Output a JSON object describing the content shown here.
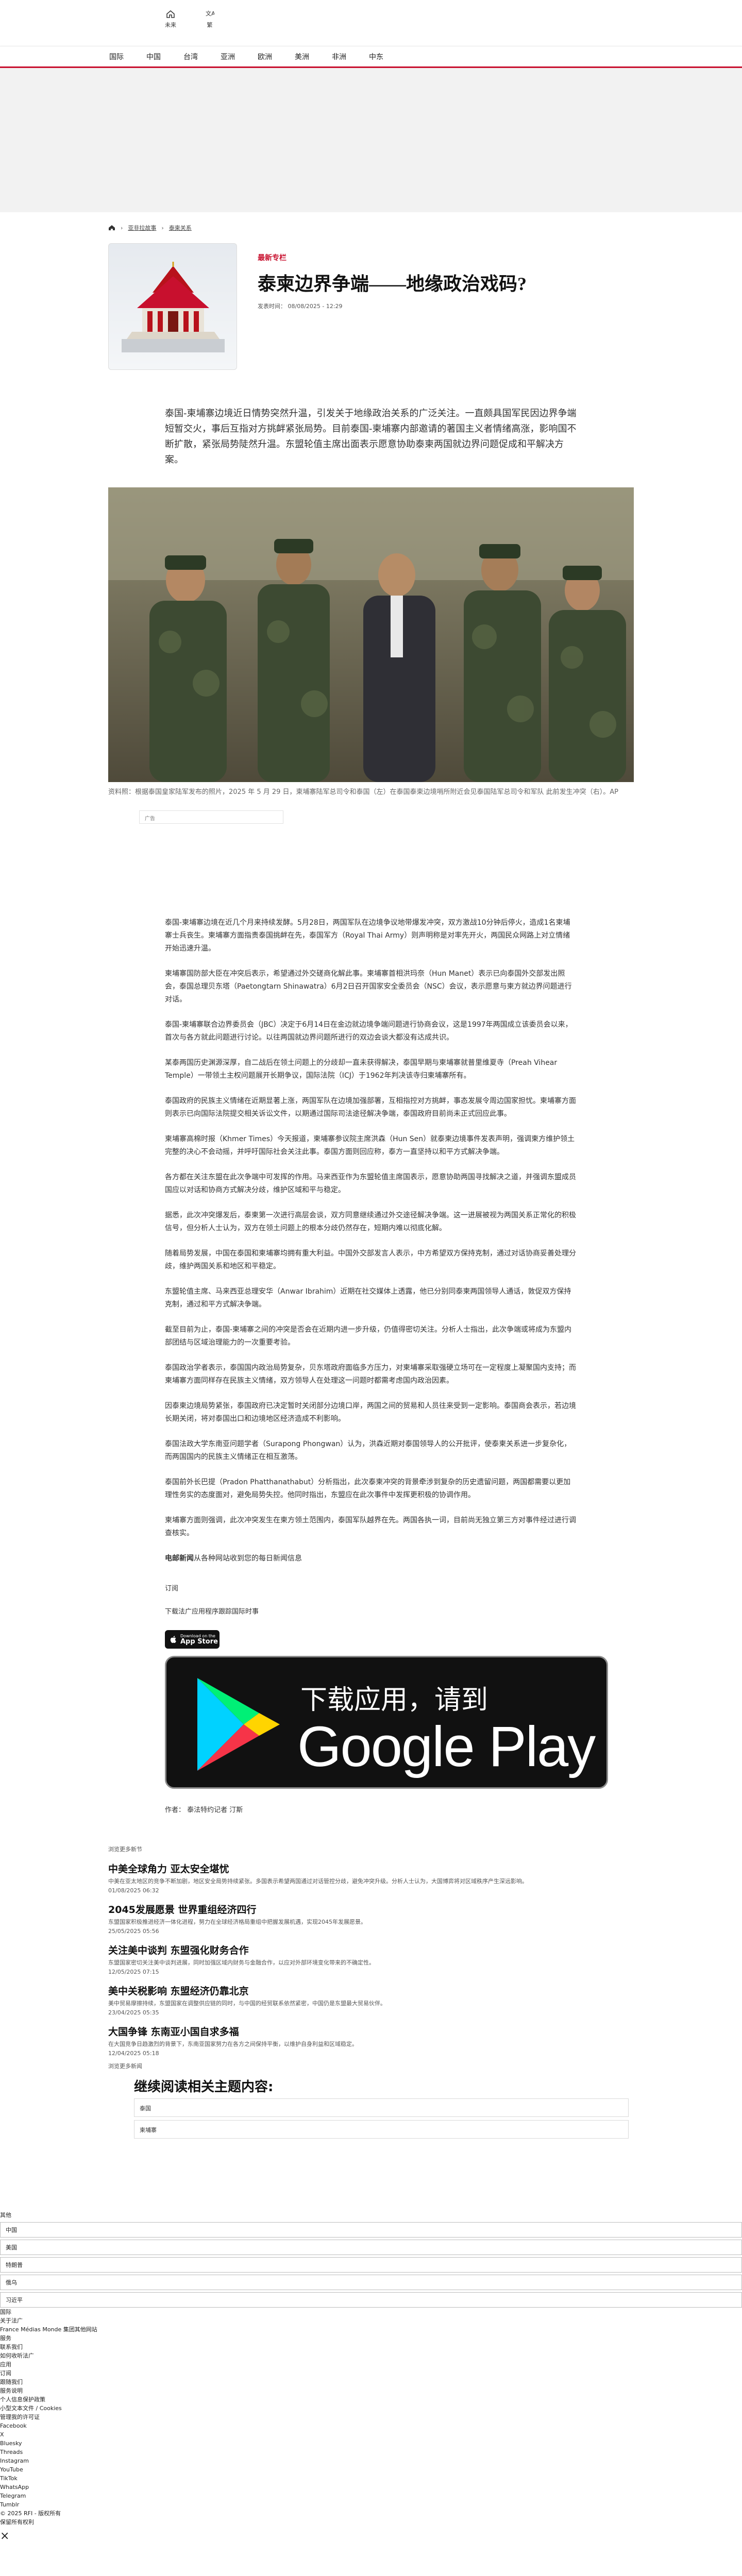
{
  "header": {
    "tools": [
      {
        "icon": "home-icon",
        "label": "未来"
      },
      {
        "icon": "translate-icon",
        "label": "繁"
      }
    ]
  },
  "nav": {
    "items": [
      "国际",
      "中国",
      "台湾",
      "亚洲",
      "欧洲",
      "美洲",
      "非洲",
      "中东"
    ]
  },
  "breadcrumb": {
    "items": [
      "亚非拉故事",
      "泰柬关系"
    ]
  },
  "article": {
    "category": "最新专栏",
    "title": "泰柬边界争端——地缘政治戏码?",
    "meta": "发表时间： 08/08/2025 - 12:29",
    "lead": "泰国-柬埔寨边境近日情势突然升温，引发关于地缘政治关系的广泛关注。一直颇具国军民因边界争端短暂交火，事后互指对方挑衅紧张局势。目前泰国-柬埔寨内部邀请的著国主义者情绪高涨，影响国不断扩散，紧张局势陡然升温。东盟轮值主席出面表示愿意协助泰柬两国就边界问题促成和平解决方案。",
    "image_caption": "资料照：根据泰国皇家陆军发布的照片，2025 年 5 月 29 日，柬埔寨陆军总司令和泰国（左）在泰国泰柬边境哨所附近会见泰国陆军总司令和军队 此前发生冲突（右）。AP",
    "ad_label": "广告",
    "paragraphs": [
      "泰国-柬埔寨边境在近几个月来持续发酵。5月28日，两国军队在边境争议地带爆发冲突，双方激战10分钟后停火，造成1名柬埔寨士兵丧生。柬埔寨方面指责泰国挑衅在先，泰国军方（Royal Thai Army）则声明称是对率先开火，两国民众网路上对立情绪开始迅速升温。",
      "柬埔寨国防部大臣在冲突后表示，希望通过外交磋商化解此事。柬埔寨首相洪玛奈（Hun Manet）表示已向泰国外交部发出照会，泰国总理贝东塔（Paetongtarn Shinawatra）6月2日召开国家安全委员会（NSC）会议，表示愿意与柬方就边界问题进行对话。",
      "泰国-柬埔寨联合边界委员会（JBC）决定于6月14日在金边就边境争端问题进行协商会议，这是1997年两国成立该委员会以来，首次与各方就此问题进行讨论。以往两国就边界问题所进行的双边会谈大都没有达成共识。",
      "某泰两国历史渊源深厚，自二战后在领土问题上的分歧却一直未获得解决，泰国早期与柬埔寨就普里维夏寺（Preah Vihear Temple）一带领土主权问题展开长期争议，国际法院（ICJ）于1962年判决该寺归柬埔寨所有。",
      "泰国政府的民族主义情绪在近期显著上涨，两国军队在边境加强部署，互相指控对方挑衅，事态发展令周边国家担忧。柬埔寨方面则表示已向国际法院提交相关诉讼文件，以期通过国际司法途径解决争端，泰国政府目前尚未正式回应此事。",
      "柬埔寨高棉时报（Khmer Times）今天报道，柬埔寨参议院主席洪森（Hun Sen）就泰柬边境事件发表声明，强调柬方维护领土完整的决心不会动摇，并呼吁国际社会关注此事。泰国方面则回应称，泰方一直坚持以和平方式解决争端。",
      "各方都在关注东盟在此次争端中可发挥的作用。马来西亚作为东盟轮值主席国表示，愿意协助两国寻找解决之道，并强调东盟成员国应以对话和协商方式解决分歧，维护区域和平与稳定。",
      "据悉，此次冲突爆发后，泰柬第一次进行高层会谈，双方同意继续通过外交途径解决争端。这一进展被视为两国关系正常化的积极信号，但分析人士认为，双方在领土问题上的根本分歧仍然存在，短期内难以彻底化解。",
      "随着局势发展，中国在泰国和柬埔寨均拥有重大利益。中国外交部发言人表示，中方希望双方保持克制，通过对话协商妥善处理分歧，维护两国关系和地区和平稳定。",
      "东盟轮值主席、马来西亚总理安华（Anwar Ibrahim）近期在社交媒体上透露，他已分别同泰柬两国领导人通话，敦促双方保持克制，通过和平方式解决争端。",
      "截至目前为止，泰国-柬埔寨之间的冲突是否会在近期内进一步升级，仍值得密切关注。分析人士指出，此次争端或将成为东盟内部团结与区域治理能力的一次重要考验。",
      "泰国政治学者表示，泰国国内政治局势复杂，贝东塔政府面临多方压力，对柬埔寨采取强硬立场可在一定程度上凝聚国内支持；而柬埔寨方面同样存在民族主义情绪，双方领导人在处理这一问题时都需考虑国内政治因素。",
      "因泰柬边境局势紧张，泰国政府已决定暂时关闭部分边境口岸，两国之间的贸易和人员往来受到一定影响。泰国商会表示，若边境长期关闭，将对泰国出口和边境地区经济造成不利影响。",
      "泰国法政大学东南亚问题学者（Surapong Phongwan）认为，洪森近期对泰国领导人的公开批评，使泰柬关系进一步复杂化，而两国国内的民族主义情绪正在相互激荡。",
      "泰国前外长巴提（Pradon Phatthanathabut）分析指出，此次泰柬冲突的背景牵涉到复杂的历史遗留问题，两国都需要以更加理性务实的态度面对，避免局势失控。他同时指出，东盟应在此次事件中发挥更积极的协调作用。",
      "柬埔寨方面则强调，此次冲突发生在柬方领土范围内，泰国军队越界在先。两国各执一词，目前尚无独立第三方对事件经过进行调查核实。"
    ],
    "more_label": "电邮新闻",
    "more_text": "从各种网站收到您的每日新闻信息",
    "subscribe": "订阅",
    "download_label": "下载法广应用程序跟踪国际时事",
    "author": "作者： 泰法特约记者 汀斯"
  },
  "apps": {
    "appstore_small": "Download on the",
    "appstore_big": "App Store",
    "gplay_cn": "下载应用，请到",
    "gplay_en": "Google Play"
  },
  "related": {
    "label": "浏览更多新节",
    "items": [
      {
        "title": "中美全球角力 亚太安全堪忧",
        "summary": "中美在亚太地区的竞争不断加剧，地区安全局势持续紧张。多国表示希望两国通过对话管控分歧，避免冲突升级。分析人士认为，大国博弈将对区域秩序产生深远影响。",
        "date": "01/08/2025 06:32"
      },
      {
        "title": "2045发展愿景 世界重组经济四行",
        "summary": "东盟国家积极推进经济一体化进程，努力在全球经济格局重组中把握发展机遇，实现2045年发展愿景。",
        "date": "25/05/2025 05:56"
      },
      {
        "title": "关注美中谈判 东盟强化财务合作",
        "summary": "东盟国家密切关注美中谈判进展，同时加强区域内财务与金融合作，以应对外部环境变化带来的不确定性。",
        "date": "12/05/2025 07:15"
      },
      {
        "title": "美中关税影响 东盟经济仍靠北京",
        "summary": "美中贸易摩擦持续，东盟国家在调整供应链的同时，与中国的经贸联系依然紧密，中国仍是东盟最大贸易伙伴。",
        "date": "23/04/2025 05:35"
      },
      {
        "title": "大国争锋 东南亚小国自求多福",
        "summary": "在大国竞争日趋激烈的背景下，东南亚国家努力在各方之间保持平衡，以维护自身利益和区域稳定。",
        "date": "12/04/2025 05:18"
      }
    ],
    "continue": "浏览更多新闻"
  },
  "topics": {
    "title": "继续阅读相关主题内容:",
    "items": [
      "泰国",
      "柬埔寨"
    ]
  },
  "footer": {
    "title": "其他",
    "fields": [
      "中国",
      "美国",
      "特朗普",
      "俄乌",
      "习近平"
    ],
    "lines": [
      "国际",
      "关于法广",
      "France Médias Monde 集团其他网站",
      "服务",
      "联系我们",
      "如何收听法广",
      "应用",
      "订阅",
      "跟随我们",
      "服务说明",
      "个人信息保护政策",
      "小型文本文件 / Cookies",
      "管理我的许可证",
      "Facebook",
      "X",
      "Bluesky",
      "Threads",
      "Instagram",
      "YouTube",
      "TikTok",
      "WhatsApp",
      "Telegram",
      "Tumblr",
      "© 2025 RFI - 版权所有",
      "保留所有权利"
    ],
    "close": "×"
  }
}
